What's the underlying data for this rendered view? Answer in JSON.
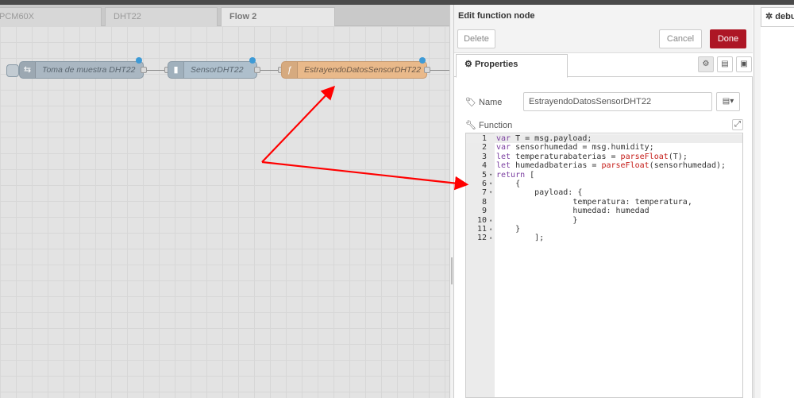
{
  "workspace": {
    "tabs": [
      {
        "label": "PCM60X"
      },
      {
        "label": "DHT22"
      },
      {
        "label": "Flow 2"
      }
    ],
    "nodes": [
      {
        "label": "Toma de muestra DHT22",
        "icon": "inject-icon"
      },
      {
        "label": "SensorDHT22",
        "icon": "sensor-icon"
      },
      {
        "label": "EstrayendoDatosSensorDHT22",
        "icon": "function-icon"
      }
    ]
  },
  "tray": {
    "title": "Edit function node",
    "delete_label": "Delete",
    "cancel_label": "Cancel",
    "done_label": "Done",
    "properties_tab": "Properties",
    "name_label": "Name",
    "name_value": "EstrayendoDatosSensorDHT22",
    "function_label": "Function",
    "code_lines": [
      "var T = msg.payload;",
      "var sensorhumedad = msg.humidity;",
      "let temperaturabaterias = parseFloat(T);",
      "let humedadbaterias = parseFloat(sensorhumedad);",
      "return [",
      "    {",
      "        payload: {",
      "                temperatura: temperatura,",
      "                humedad: humedad",
      "                }",
      "    }",
      "        ];"
    ]
  },
  "debug": {
    "tab_label": "debu"
  },
  "colors": {
    "done_button": "#ad1625",
    "function_node": "#e9b98a",
    "arrow": "#ff0000"
  }
}
